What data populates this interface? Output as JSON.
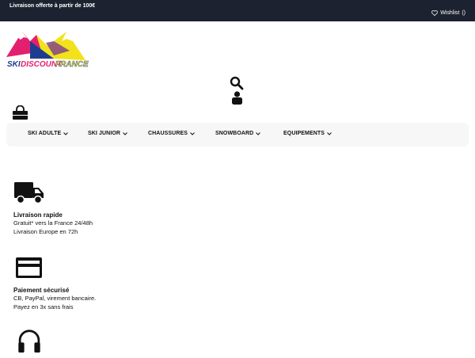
{
  "topbar": {
    "promo": "Livraison offerte à partir de 100€",
    "wishlist_label": "Wishlist",
    "wishlist_count": "()"
  },
  "logo": {
    "word1": "SKI",
    "word2": "DISCOUNT",
    "word3": "FRANCE",
    "colors": {
      "pink": "#e3206f",
      "yellow": "#f2e21b",
      "blue": "#1f3d8f"
    }
  },
  "header_icons": [
    "search-icon",
    "user-icon",
    "cart-icon"
  ],
  "nav": {
    "items": [
      {
        "label": "SKI ADULTE"
      },
      {
        "label": "SKI JUNIOR"
      },
      {
        "label": "CHAUSSURES"
      },
      {
        "label": "SNOWBOARD"
      },
      {
        "label": "EQUIPEMENTS"
      }
    ]
  },
  "features": [
    {
      "icon": "truck-icon",
      "title": "Livraison rapide",
      "lines": [
        "Gratuit* vers la France 24/48h",
        "Livraison Europe en 72h"
      ]
    },
    {
      "icon": "credit-card-icon",
      "title": "Paiement sécurisé",
      "lines": [
        "CB, PayPal, virement bancaire.",
        "Payez en 3x sans frais"
      ]
    },
    {
      "icon": "headset-icon",
      "title": "",
      "lines": []
    }
  ]
}
